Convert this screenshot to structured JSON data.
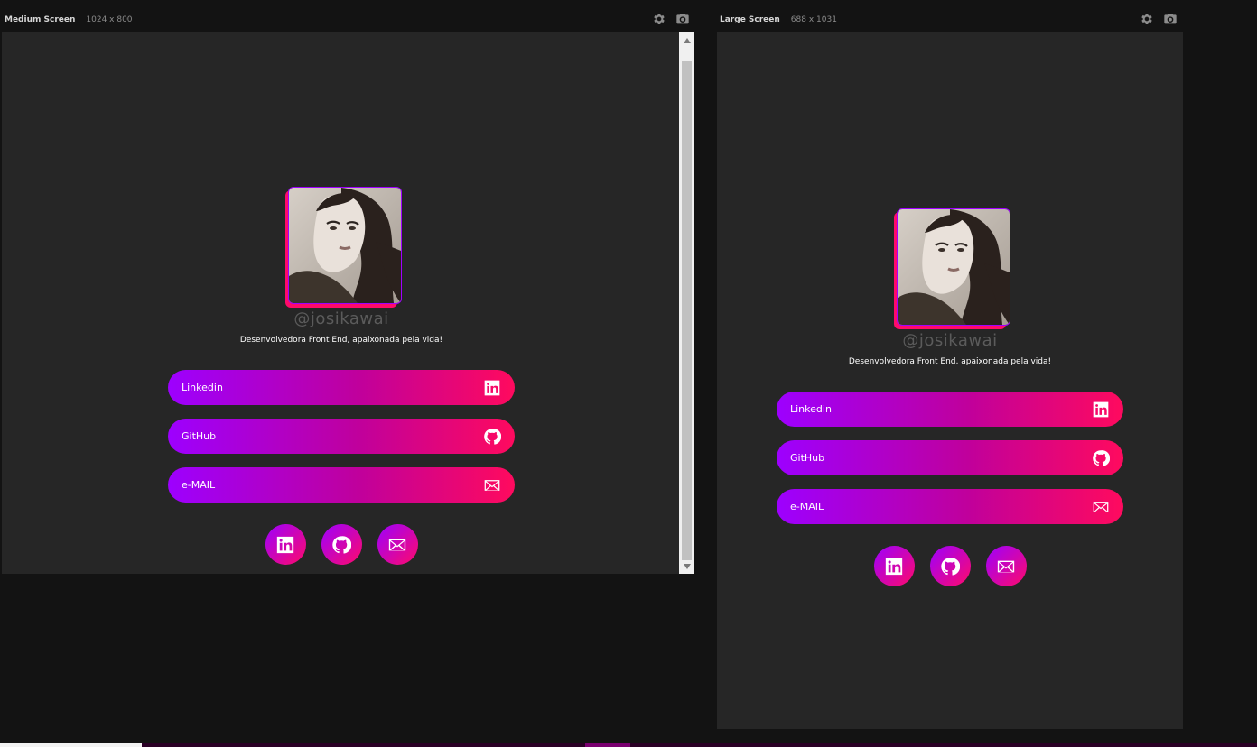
{
  "panels": [
    {
      "title": "Medium Screen",
      "dims": "1024 x 800"
    },
    {
      "title": "Large Screen",
      "dims": "688 x 1031"
    }
  ],
  "header_icons": [
    "gear-icon",
    "camera-icon"
  ],
  "profile": {
    "handle": "@josikawai",
    "bio": "Desenvolvedora Front End, apaixonada pela vida!",
    "links": [
      {
        "label": "Linkedin",
        "icon": "linkedin-icon"
      },
      {
        "label": "GitHub",
        "icon": "github-icon"
      },
      {
        "label": "e-MAIL",
        "icon": "mail-icon"
      }
    ],
    "socials": [
      "linkedin-icon",
      "github-icon",
      "mail-icon"
    ]
  },
  "colors": {
    "gradient_start": "#9d00ff",
    "gradient_end": "#ff0a5e",
    "viewport_bg": "#262626",
    "page_bg": "#131313",
    "handle_color": "#5b5b5b"
  }
}
